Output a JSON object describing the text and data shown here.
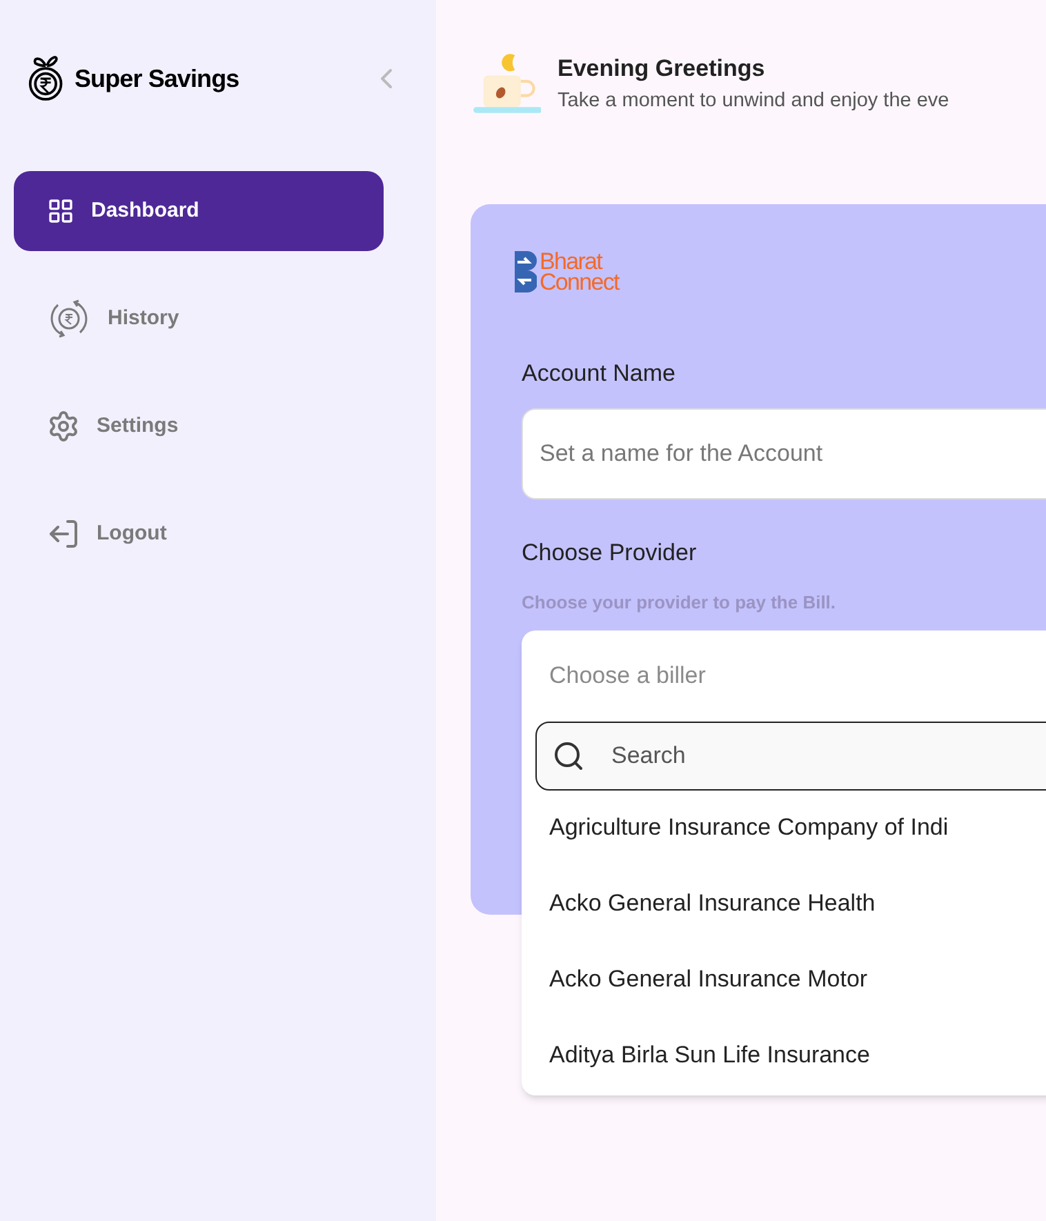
{
  "sidebar": {
    "brand": "Super Savings",
    "items": [
      {
        "label": "Dashboard",
        "kind": "grid",
        "selected": true
      },
      {
        "label": "History",
        "kind": "history",
        "selected": false
      },
      {
        "label": "Settings",
        "kind": "gear",
        "selected": false
      },
      {
        "label": "Logout",
        "kind": "logout",
        "selected": false
      }
    ]
  },
  "greeting": {
    "title": "Evening Greetings",
    "subtitle": "Take a moment to unwind and enjoy the eve"
  },
  "form": {
    "logo": [
      "Bharat",
      "Connect"
    ],
    "account_label": "Account Name",
    "account_placeholder": "Set a name for the Account",
    "provider_label": "Choose Provider",
    "provider_hint": "Choose your provider to pay the Bill.",
    "dropdown": {
      "placeholder": "Choose a biller",
      "search_placeholder": "Search",
      "options": [
        "Agriculture Insurance Company of Indi",
        "Acko General Insurance Health",
        "Acko General Insurance Motor",
        "Aditya Birla Sun Life Insurance"
      ]
    }
  }
}
